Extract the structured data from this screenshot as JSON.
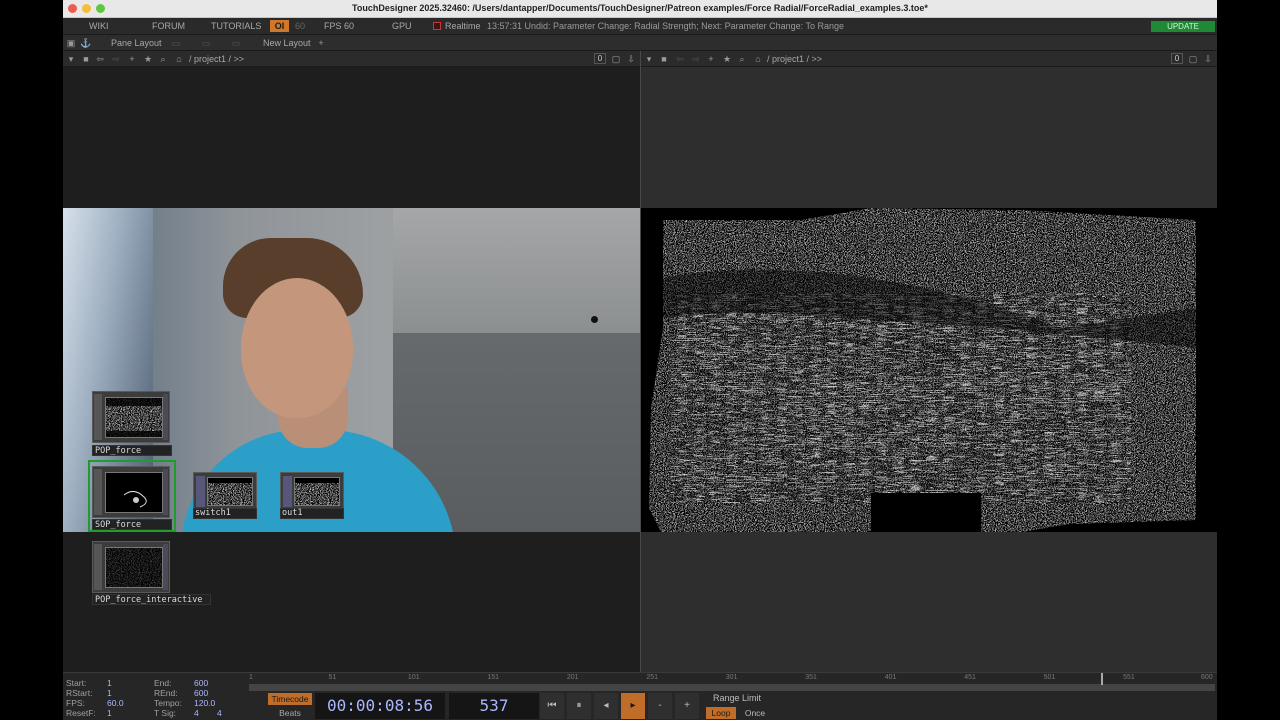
{
  "window": {
    "title": "TouchDesigner 2025.32460: /Users/dantapper/Documents/TouchDesigner/Patreon examples/Force Radial/ForceRadial_examples.3.toe*"
  },
  "menubar": {
    "wiki": "WIKI",
    "forum": "FORUM",
    "tutorials": "TUTORIALS",
    "oi": "OI",
    "oi_value": "60",
    "fps_label": "FPS",
    "fps_value": "60",
    "gpu": "GPU",
    "realtime": "Realtime",
    "status": "13:57:31 Undid: Parameter Change: Radial Strength; Next: Parameter Change: To Range",
    "update": "UPDATE"
  },
  "panebar": {
    "pane_layout": "Pane Layout",
    "new_layout": "New Layout"
  },
  "left_pane": {
    "path": "/ project1 / >>",
    "counter": "0"
  },
  "right_pane": {
    "path": "/ project1 / >>",
    "counter": "0"
  },
  "nodes": [
    {
      "name": "POP_force"
    },
    {
      "name": "SOP_force"
    },
    {
      "name": "switch1"
    },
    {
      "name": "out1"
    },
    {
      "name": "POP_force_interactive"
    }
  ],
  "timeline": {
    "start_label": "Start:",
    "start_value": "1",
    "end_label": "End:",
    "end_value": "600",
    "rstart_label": "RStart:",
    "rstart_value": "1",
    "rend_label": "REnd:",
    "rend_value": "600",
    "fps_label": "FPS:",
    "fps_value": "60.0",
    "tempo_label": "Tempo:",
    "tempo_value": "120.0",
    "resetf_label": "ResetF:",
    "resetf_value": "1",
    "tsig_label": "T Sig:",
    "tsig_value_a": "4",
    "tsig_value_b": "4",
    "ticks": [
      "1",
      "51",
      "101",
      "151",
      "201",
      "251",
      "301",
      "351",
      "401",
      "451",
      "501",
      "551",
      "600"
    ],
    "timecode_btn": "Timecode",
    "beats_btn": "Beats",
    "timecode": "00:00:08:56",
    "frame": "537",
    "range_limit": "Range Limit",
    "loop": "Loop",
    "once": "Once",
    "current_frame": 537,
    "range_end": 600
  }
}
